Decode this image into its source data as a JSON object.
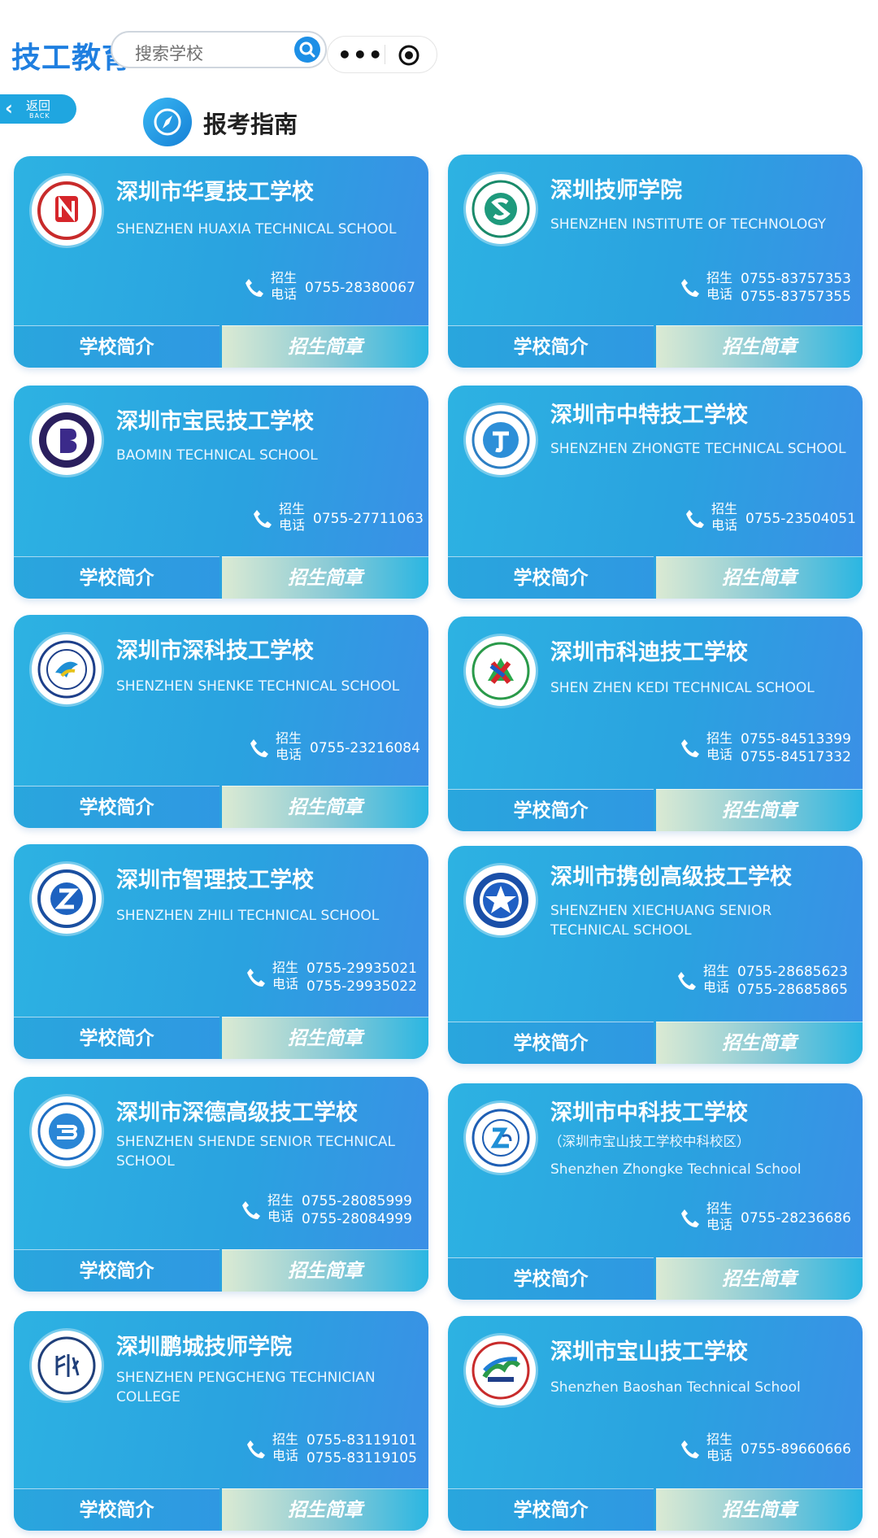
{
  "header": {
    "app_logo": "技工教育",
    "search_placeholder": "搜索学校",
    "more_icon": "more-dots-icon",
    "capsule_icon": "target-circle-icon"
  },
  "back": {
    "label": "返回",
    "sublabel": "BACK"
  },
  "section": {
    "title": "报考指南",
    "icon": "compass-icon"
  },
  "phone_label_1": "招生",
  "phone_label_2": "电话",
  "buttons": {
    "intro": "学校简介",
    "brochure": "招生简章"
  },
  "schools": [
    {
      "name": "深圳市华夏技工学校",
      "subtitle": "",
      "en": "SHENZHEN HUAXIA TECHNICAL SCHOOL",
      "phone1": "0755-28380067",
      "phone2": ""
    },
    {
      "name": "深圳技师学院",
      "subtitle": "",
      "en": "SHENZHEN INSTITUTE OF TECHNOLOGY",
      "phone1": "0755-83757353",
      "phone2": "0755-83757355"
    },
    {
      "name": "深圳市宝民技工学校",
      "subtitle": "",
      "en": "BAOMIN TECHNICAL SCHOOL",
      "phone1": "0755-27711063",
      "phone2": ""
    },
    {
      "name": "深圳市中特技工学校",
      "subtitle": "",
      "en": "SHENZHEN ZHONGTE TECHNICAL SCHOOL",
      "phone1": "0755-23504051",
      "phone2": ""
    },
    {
      "name": "深圳市深科技工学校",
      "subtitle": "",
      "en": "SHENZHEN SHENKE TECHNICAL SCHOOL",
      "phone1": "0755-23216084",
      "phone2": ""
    },
    {
      "name": "深圳市科迪技工学校",
      "subtitle": "",
      "en": "SHEN ZHEN KEDI TECHNICAL SCHOOL",
      "phone1": "0755-84513399",
      "phone2": "0755-84517332"
    },
    {
      "name": "深圳市智理技工学校",
      "subtitle": "",
      "en": "SHENZHEN ZHILI TECHNICAL SCHOOL",
      "phone1": "0755-29935021",
      "phone2": "0755-29935022"
    },
    {
      "name": "深圳市携创高级技工学校",
      "subtitle": "",
      "en": "SHENZHEN XIECHUANG SENIOR TECHNICAL SCHOOL",
      "phone1": "0755-28685623",
      "phone2": "0755-28685865"
    },
    {
      "name": "深圳市深德高级技工学校",
      "subtitle": "",
      "en": "SHENZHEN SHENDE SENIOR TECHNICAL SCHOOL",
      "phone1": "0755-28085999",
      "phone2": "0755-28084999"
    },
    {
      "name": "深圳市中科技工学校",
      "subtitle": "（深圳市宝山技工学校中科校区）",
      "en": "Shenzhen Zhongke Technical School",
      "phone1": "0755-28236686",
      "phone2": ""
    },
    {
      "name": "深圳鹏城技师学院",
      "subtitle": "",
      "en": "SHENZHEN PENGCHENG TECHNICIAN COLLEGE",
      "phone1": "0755-83119101",
      "phone2": "0755-83119105"
    },
    {
      "name": "深圳市宝山技工学校",
      "subtitle": "",
      "en": "Shenzhen Baoshan Technical School",
      "phone1": "0755-89660666",
      "phone2": ""
    }
  ]
}
